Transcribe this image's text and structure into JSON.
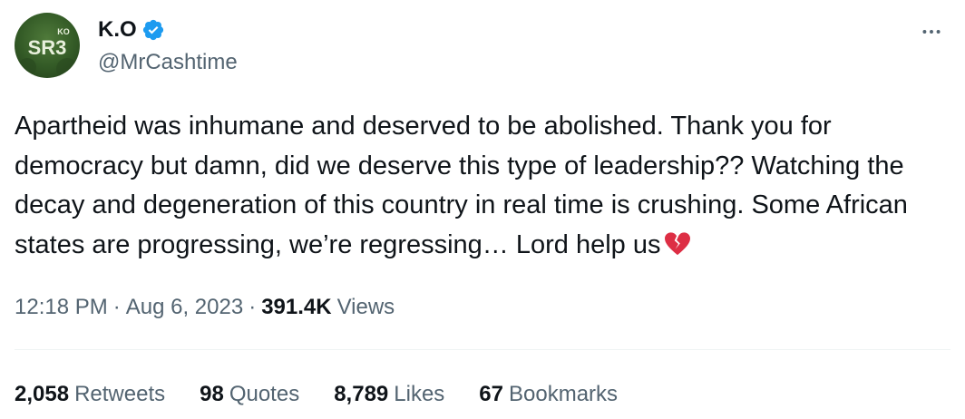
{
  "author": {
    "display_name": "K.O",
    "handle": "@MrCashtime",
    "avatar_text": "SR3",
    "avatar_small_text": "KO",
    "verified": true,
    "verified_color": "#1d9bf0"
  },
  "more_menu": {
    "icon": "more-horizontal-icon"
  },
  "tweet": {
    "text": "Apartheid was inhumane and deserved to be abolished. Thank you for democracy but damn, did we deserve this type of leadership?? Watching the decay and degeneration of this country in real time is crushing. Some African states are progressing, we’re regressing… Lord help us",
    "emoji": "broken-heart-icon"
  },
  "meta": {
    "time": "12:18 PM",
    "separator": "·",
    "date": "Aug 6, 2023",
    "views_count": "391.4K",
    "views_label": "Views"
  },
  "stats": [
    {
      "count": "2,058",
      "label": "Retweets"
    },
    {
      "count": "98",
      "label": "Quotes"
    },
    {
      "count": "8,789",
      "label": "Likes"
    },
    {
      "count": "67",
      "label": "Bookmarks"
    }
  ],
  "colors": {
    "text_primary": "#0f1419",
    "text_secondary": "#536471",
    "divider": "#eff3f4",
    "heart": "#e0245e"
  }
}
